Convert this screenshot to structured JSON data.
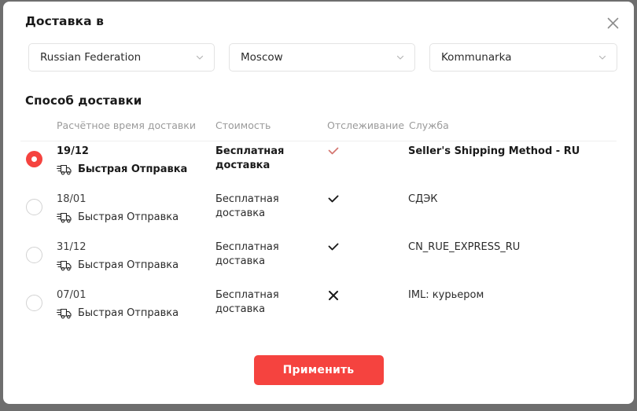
{
  "dialog": {
    "ship_to_title": "Доставка в",
    "method_title": "Способ доставки",
    "close_icon": "close-icon"
  },
  "location": {
    "country": {
      "value": "Russian Federation",
      "icon": "chevron-down-icon"
    },
    "region": {
      "value": "Moscow",
      "icon": "chevron-down-icon"
    },
    "city": {
      "value": "Kommunarka",
      "icon": "chevron-down-icon"
    }
  },
  "table": {
    "headers": {
      "eta": "Расчётное время доставки",
      "cost": "Стоимость",
      "tracking": "Отслеживание",
      "service": "Служба"
    },
    "rows": [
      {
        "selected": true,
        "date": "19/12",
        "shipping": "Быстрая Отправка",
        "shipping_icon": "truck-icon",
        "cost": "Бесплатная доставка",
        "tracking": "check",
        "tracking_icon": "check-icon",
        "service": "Seller's Shipping Method - RU"
      },
      {
        "selected": false,
        "date": "18/01",
        "shipping": "Быстрая Отправка",
        "shipping_icon": "truck-icon",
        "cost": "Бесплатная доставка",
        "tracking": "check",
        "tracking_icon": "check-icon",
        "service": "СДЭК"
      },
      {
        "selected": false,
        "date": "31/12",
        "shipping": "Быстрая Отправка",
        "shipping_icon": "truck-icon",
        "cost": "Бесплатная доставка",
        "tracking": "check",
        "tracking_icon": "check-icon",
        "service": "CN_RUE_EXPRESS_RU"
      },
      {
        "selected": false,
        "date": "07/01",
        "shipping": "Быстрая Отправка",
        "shipping_icon": "truck-icon",
        "cost": "Бесплатная доставка",
        "tracking": "cross",
        "tracking_icon": "close-icon",
        "service": "IML: курьером"
      }
    ]
  },
  "footer": {
    "apply_label": "Применить"
  },
  "colors": {
    "accent": "#f5433f",
    "selected_check": "#d4756f",
    "text": "#2b2b2b",
    "muted": "#9a9a9a",
    "border": "#e3e3e3"
  }
}
